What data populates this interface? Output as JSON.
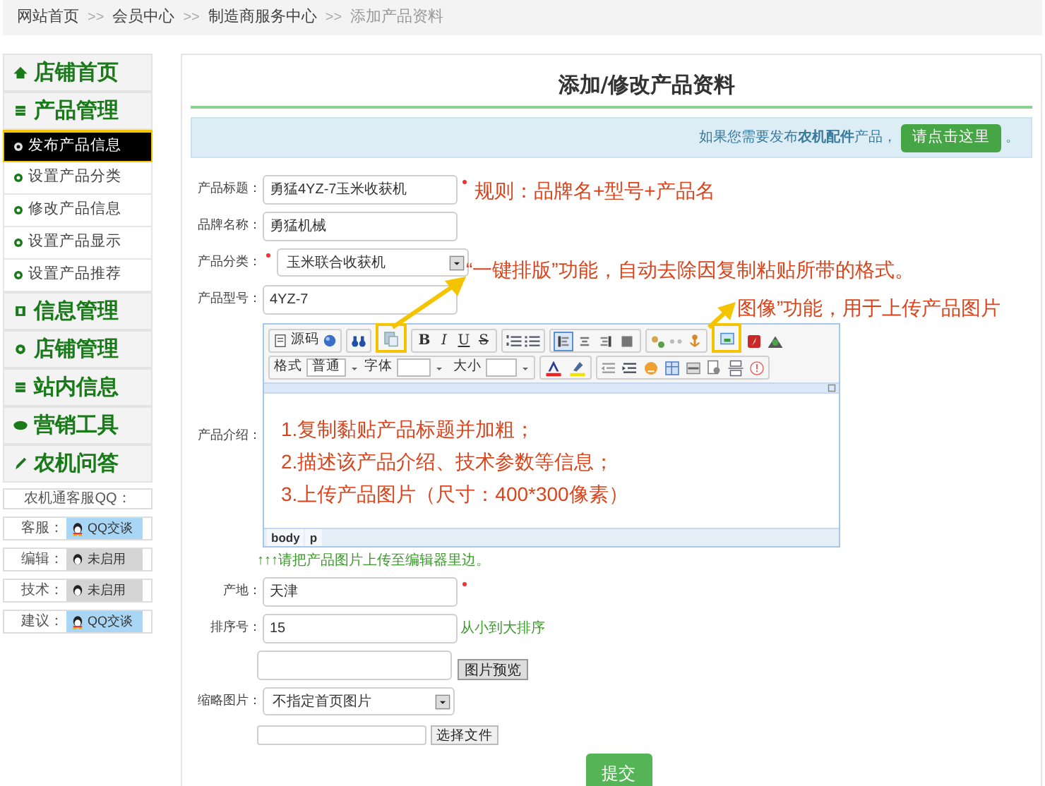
{
  "breadcrumb": [
    "网站首页",
    "会员中心",
    "制造商服务中心",
    "添加产品资料"
  ],
  "breadcrumb_separator": ">>",
  "sidebar": {
    "items": [
      {
        "kind": "section",
        "label": "店铺首页",
        "selected": false
      },
      {
        "kind": "section",
        "label": "产品管理",
        "selected": false
      },
      {
        "kind": "sub",
        "label": "发布产品信息",
        "selected": true
      },
      {
        "kind": "sub",
        "label": "设置产品分类",
        "selected": false
      },
      {
        "kind": "sub",
        "label": "修改产品信息",
        "selected": false
      },
      {
        "kind": "sub",
        "label": "设置产品显示",
        "selected": false
      },
      {
        "kind": "sub",
        "label": "设置产品推荐",
        "selected": false
      },
      {
        "kind": "section",
        "label": "信息管理",
        "selected": false
      },
      {
        "kind": "section",
        "label": "店铺管理",
        "selected": false
      },
      {
        "kind": "section",
        "label": "站内信息",
        "selected": false
      },
      {
        "kind": "section",
        "label": "营销工具",
        "selected": false
      },
      {
        "kind": "section",
        "label": "农机问答",
        "selected": false
      }
    ],
    "qq_title": "农机通客服QQ：",
    "qq": [
      {
        "label": "客服：",
        "button": "QQ交谈",
        "active": true
      },
      {
        "label": "编辑：",
        "button": "未启用",
        "active": false
      },
      {
        "label": "技术：",
        "button": "未启用",
        "active": false
      },
      {
        "label": "建议：",
        "button": "QQ交谈",
        "active": true
      }
    ]
  },
  "page_title": "添加/修改产品资料",
  "notice": {
    "text": "如果您需要发布**农机配件**产品，",
    "button": "请点击这里",
    "tail": "。"
  },
  "fields": [
    {
      "kind": "text",
      "label": "产品标题：",
      "value": "勇猛4YZ-7玉米收获机",
      "required": true
    },
    {
      "kind": "text",
      "label": "品牌名称：",
      "value": "勇猛机械",
      "required": false
    },
    {
      "kind": "select",
      "label": "产品分类：",
      "value": "玉米联合收获机",
      "required": true
    },
    {
      "kind": "text",
      "label": "产品型号：",
      "value": "4YZ-7",
      "required": false
    },
    {
      "kind": "editor",
      "label": "产品介绍："
    },
    {
      "kind": "hint",
      "text": "↑↑↑请把产品图片上传至编辑器里边。"
    },
    {
      "kind": "text",
      "label": "产地：",
      "value": "天津",
      "required": true
    },
    {
      "kind": "text",
      "label": "排序号：",
      "value": "15",
      "required": false,
      "note": "从小到大排序"
    },
    {
      "kind": "preview",
      "button": "图片预览"
    },
    {
      "kind": "select",
      "label": "缩略图片：",
      "value": "不指定首页图片",
      "required": false
    },
    {
      "kind": "file",
      "button": "选择文件"
    }
  ],
  "editor": {
    "source_button": "源码",
    "styles": [
      "B",
      "I",
      "U",
      "S"
    ],
    "alignment": [
      {
        "selected": true
      },
      {
        "selected": false
      },
      {
        "selected": false
      },
      {
        "selected": false
      }
    ],
    "format_label": "格式",
    "format_value": "普通",
    "font_label": "字体",
    "size_label": "大小",
    "body": [
      "1.复制黏贴产品标题并加粗；",
      "2.描述该产品介绍、技术参数等信息；",
      "3.上传产品图片（尺寸：400*300像素）"
    ],
    "path": [
      "body",
      "p"
    ]
  },
  "submit": "提交",
  "annotations": [
    "规则：品牌名+型号+产品名",
    "“一键排版”功能，自动去除因复制粘贴所带的格式。",
    "图像”功能，用于上传产品图片"
  ]
}
